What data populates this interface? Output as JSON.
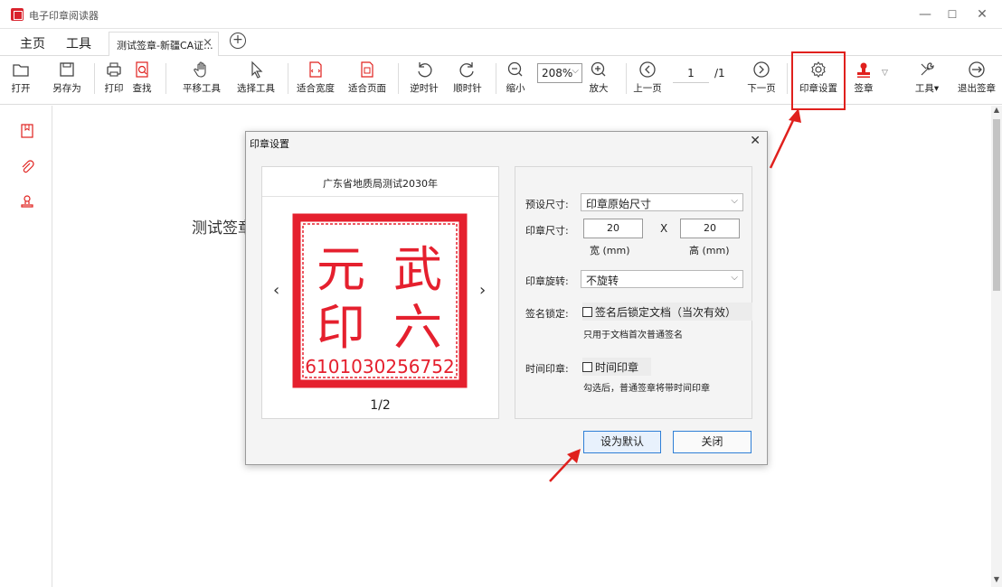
{
  "app": {
    "title": "电子印章阅读器"
  },
  "window_controls": {
    "minimize": "—",
    "maximize": "☐",
    "close": "✕"
  },
  "tabs": {
    "home": "主页",
    "tools": "工具",
    "doc_tab": "测试签章-新疆CA证...",
    "doc_close": "×",
    "new_tab": "+"
  },
  "toolbar": {
    "open": "打开",
    "save_as": "另存为",
    "print": "打印",
    "find": "查找",
    "pan": "平移工具",
    "select": "选择工具",
    "fit_width": "适合宽度",
    "fit_page": "适合页面",
    "rotate_ccw": "逆时针",
    "rotate_cw": "顺时针",
    "zoom_out": "缩小",
    "zoom_value": "208%",
    "zoom_in": "放大",
    "prev_page": "上一页",
    "page_current": "1",
    "page_total": "/1",
    "next_page": "下一页",
    "seal_settings": "印章设置",
    "sign": "签章",
    "tools": "工具",
    "exit_sign": "退出签章"
  },
  "document": {
    "text_fragment": "测试签章"
  },
  "dialog": {
    "title": "印章设置",
    "close": "✕",
    "preview": {
      "title": "广东省地质局测试2030年",
      "page_indicator": "1/2",
      "prev": "‹",
      "next": "›",
      "seal": {
        "chars": [
          "元",
          "武",
          "印",
          "六"
        ],
        "number": "6101030256752",
        "color": "#e5202e"
      }
    },
    "settings": {
      "preset_size_label": "预设尺寸:",
      "preset_size_value": "印章原始尺寸",
      "seal_size_label": "印章尺寸:",
      "width_value": "20",
      "height_value": "20",
      "x_sep": "X",
      "width_unit": "宽 (mm)",
      "height_unit": "高 (mm)",
      "rotation_label": "印章旋转:",
      "rotation_value": "不旋转",
      "lock_label": "签名锁定:",
      "lock_checkbox": "签名后锁定文档（当次有效）",
      "lock_note": "只用于文档首次普通签名",
      "time_label": "时间印章:",
      "time_checkbox": "时间印章",
      "time_note": "勾选后，普通签章将带时间印章"
    },
    "buttons": {
      "set_default": "设为默认",
      "close": "关闭"
    }
  },
  "colors": {
    "accent": "#e0201d",
    "button_border": "#2f7fd6",
    "seal_red": "#e5202e"
  }
}
